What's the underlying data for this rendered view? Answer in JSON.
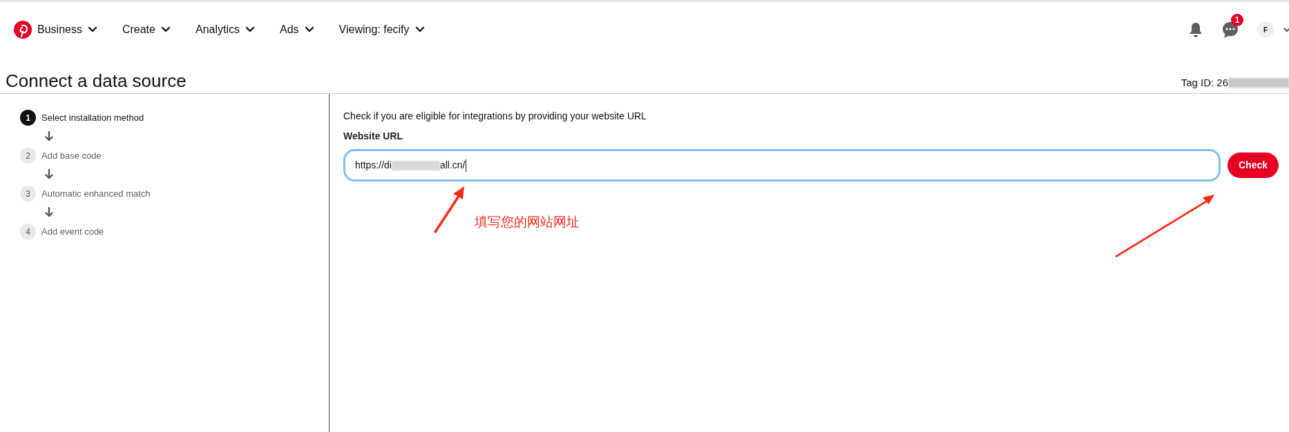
{
  "nav": {
    "items": [
      {
        "label": "Business"
      },
      {
        "label": "Create"
      },
      {
        "label": "Analytics"
      },
      {
        "label": "Ads"
      },
      {
        "label": "Viewing: fecify"
      }
    ],
    "message_badge": "1",
    "avatar": "F"
  },
  "page": {
    "title": "Connect a data source",
    "tag_id": "Tag ID: 26"
  },
  "steps": [
    {
      "number": "1",
      "label": "Select installation method",
      "selected": true
    },
    {
      "number": "2",
      "label": "Add base code",
      "selected": false
    },
    {
      "number": "3",
      "label": "Automatic enhanced match",
      "selected": false
    },
    {
      "number": "4",
      "label": "Add event code",
      "selected": false
    }
  ],
  "form": {
    "prompt": "Check if you are eligible for integrations by providing your website URL",
    "label": "Website URL",
    "value_start": "https://di",
    "value_end": "all.cn/",
    "button": "Check"
  },
  "annotation": {
    "text": "填写您的网站网址"
  }
}
